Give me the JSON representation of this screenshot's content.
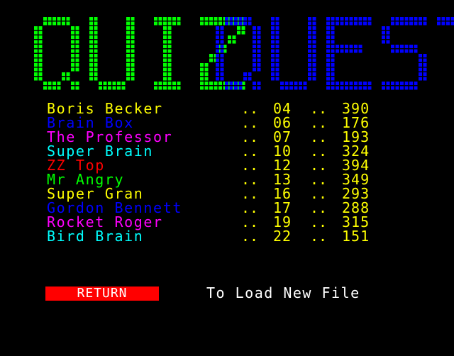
{
  "title": {
    "word1": "QUIZ",
    "word2": "QUEST",
    "word1_color": "#00ff00",
    "word2_color": "#0000ff"
  },
  "dots_text": "..",
  "scores": [
    {
      "name": "Boris Becker",
      "level": "04",
      "score": "390",
      "color": "#ffff00"
    },
    {
      "name": "Brain Box",
      "level": "06",
      "score": "176",
      "color": "#0000ff"
    },
    {
      "name": "The Professor",
      "level": "07",
      "score": "193",
      "color": "#ff00ff"
    },
    {
      "name": "Super Brain",
      "level": "10",
      "score": "324",
      "color": "#00ffff"
    },
    {
      "name": "ZZ Top",
      "level": "12",
      "score": "394",
      "color": "#ff0000"
    },
    {
      "name": "Mr Angry",
      "level": "13",
      "score": "349",
      "color": "#00ff00"
    },
    {
      "name": "Super Gran",
      "level": "16",
      "score": "293",
      "color": "#ffff00"
    },
    {
      "name": "Gordon Bennett",
      "level": "17",
      "score": "288",
      "color": "#0000ff"
    },
    {
      "name": "Rocket Roger",
      "level": "19",
      "score": "315",
      "color": "#ff00ff"
    },
    {
      "name": "Bird Brain",
      "level": "22",
      "score": "151",
      "color": "#00ffff"
    }
  ],
  "return_label": "RETURN",
  "load_text": "To Load New File"
}
